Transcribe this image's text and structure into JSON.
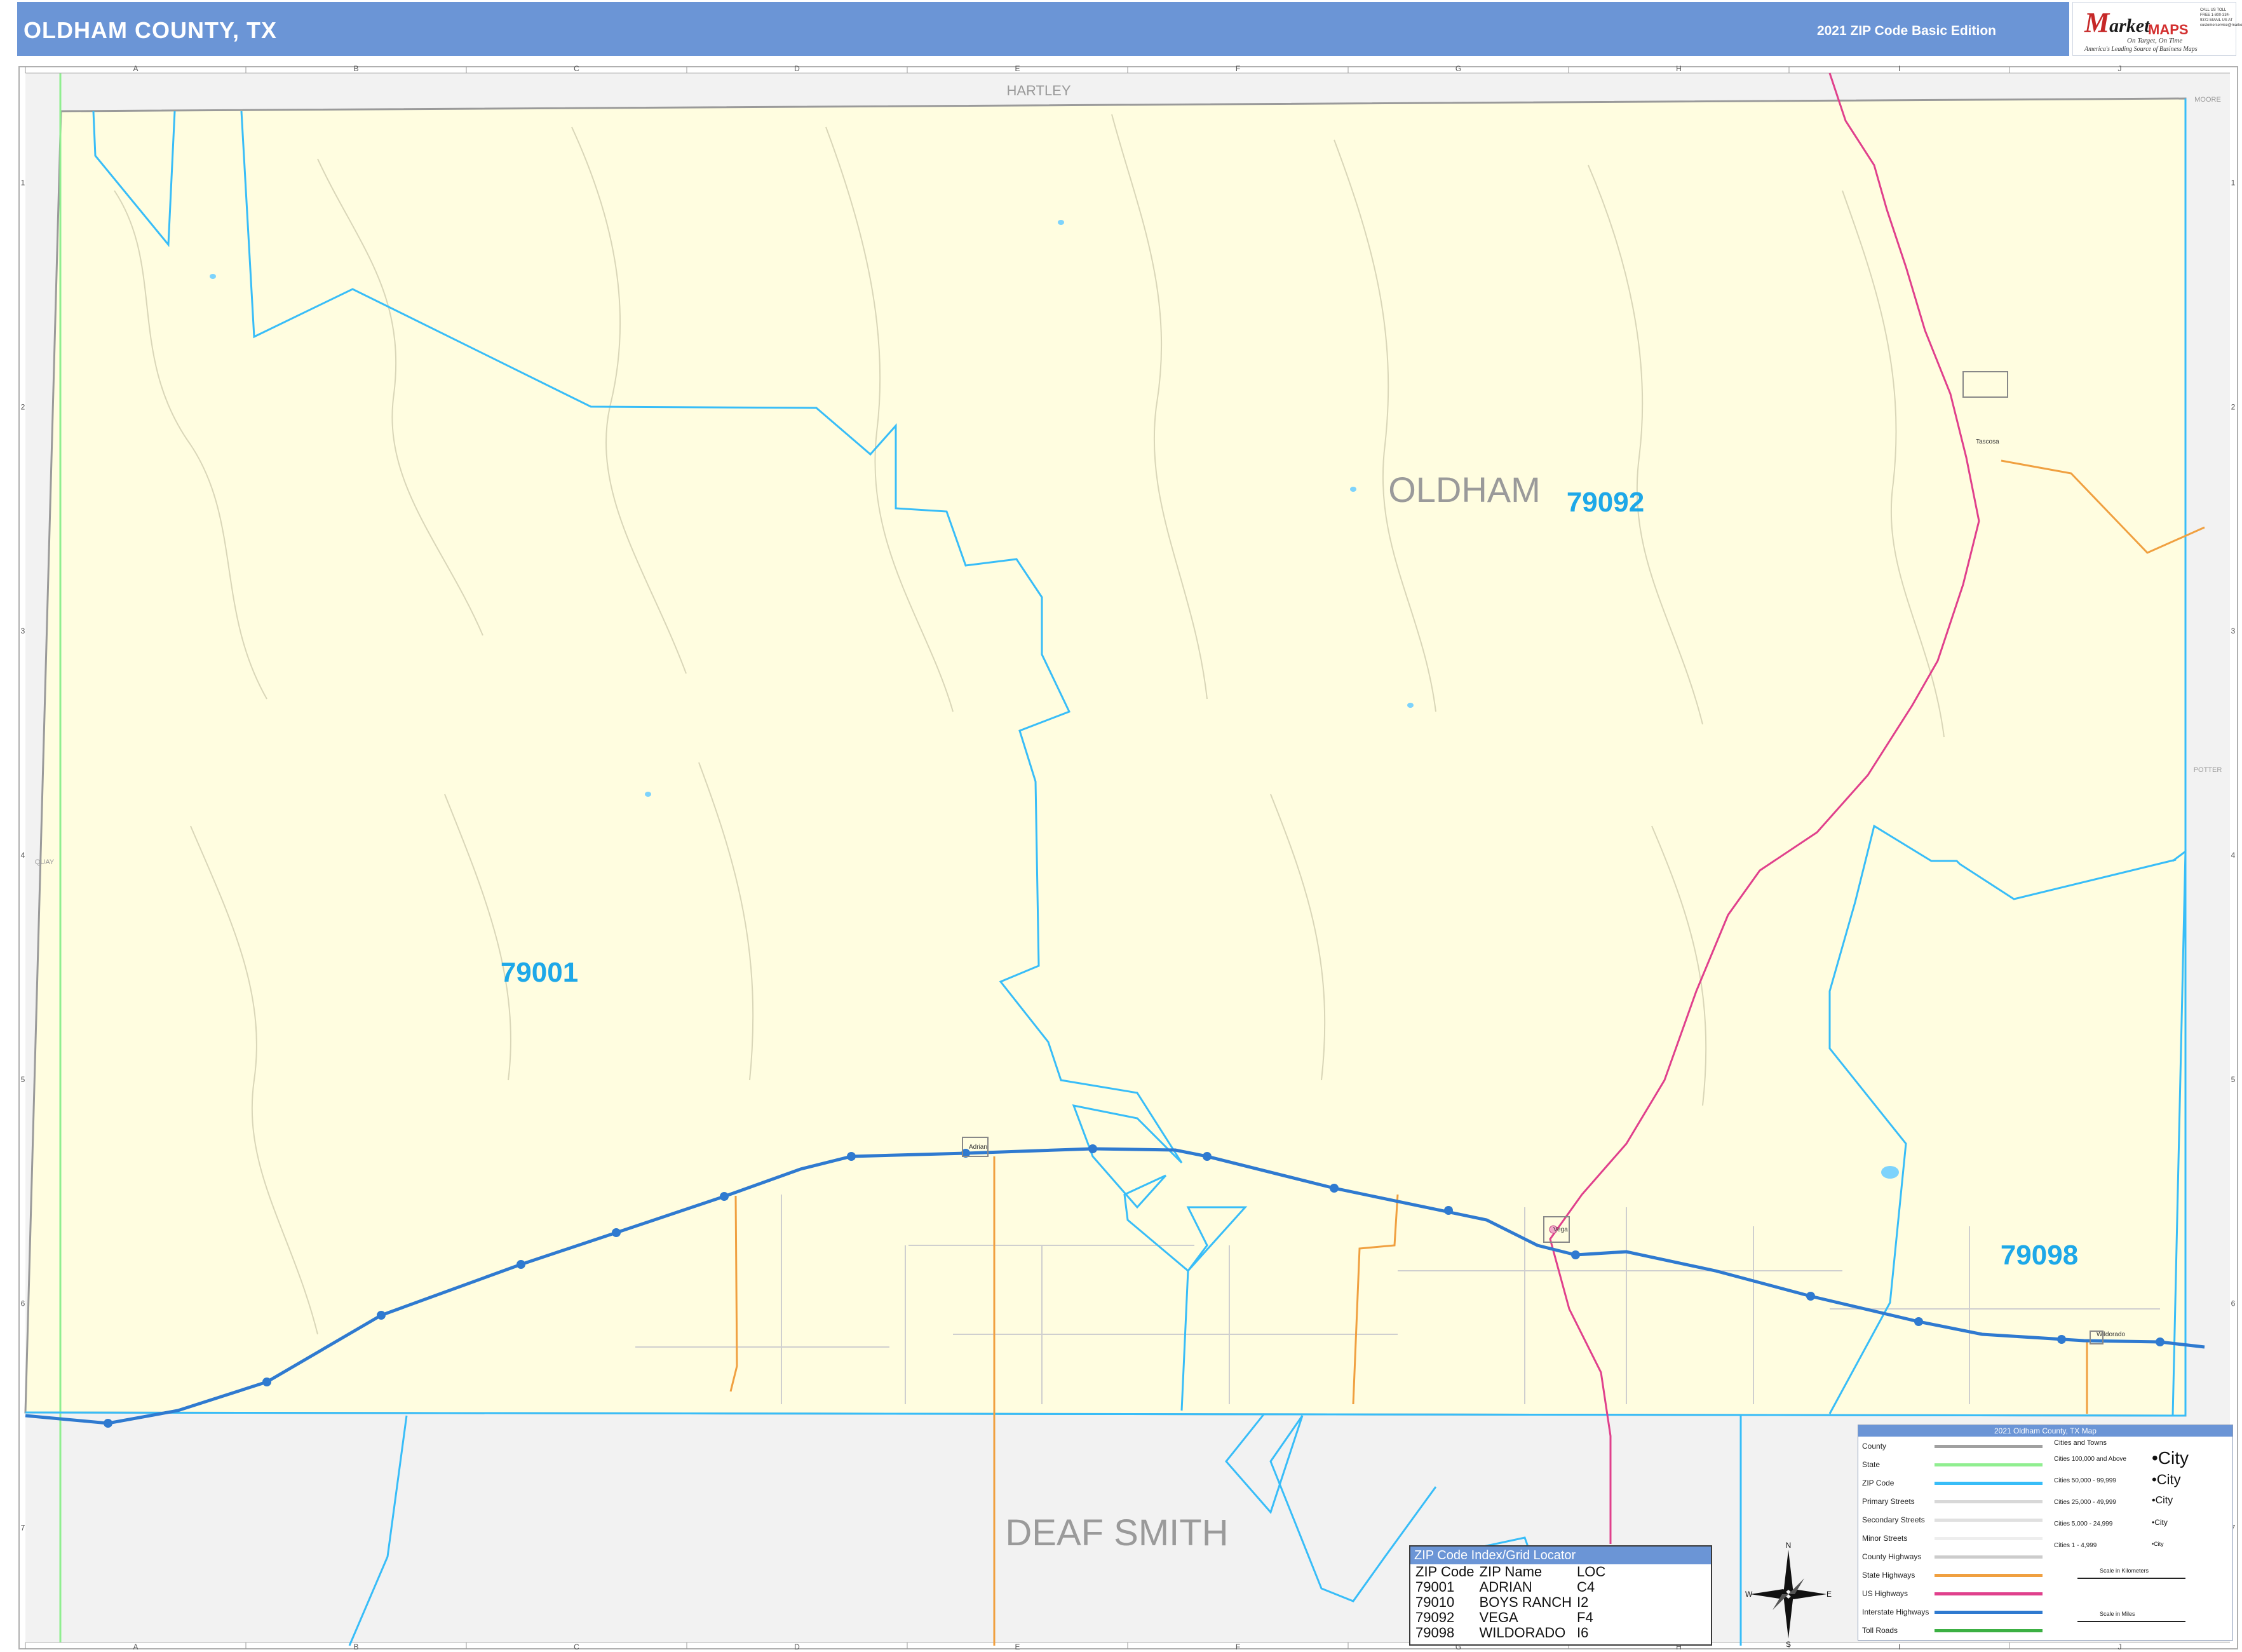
{
  "header": {
    "title": "OLDHAM COUNTY, TX",
    "edition": "2021 ZIP Code Basic Edition"
  },
  "logo": {
    "brand": "arket",
    "brand_letter": "M",
    "maps": "MAPS",
    "tagline": "On Target, On Time",
    "slogan": "America's Leading Source of Business Maps",
    "contact": "CALL US TOLL FREE 1-800-334-9372 EMAIL US AT customerservice@marketmaps.com"
  },
  "grid": {
    "columns": [
      "A",
      "B",
      "C",
      "D",
      "E",
      "F",
      "G",
      "H",
      "I",
      "J"
    ],
    "rows": [
      "1",
      "2",
      "3",
      "4",
      "5",
      "6",
      "7"
    ]
  },
  "counties": {
    "center": "OLDHAM",
    "north": "HARTLEY",
    "south": "DEAF SMITH",
    "west": "QUAY",
    "east": "POTTER",
    "northeast": "MOORE"
  },
  "zip_labels": [
    "79001",
    "79092",
    "79098"
  ],
  "places": [
    "Vega",
    "Adrian",
    "Wildorado",
    "Tascosa"
  ],
  "zip_index": {
    "title": "ZIP Code Index/Grid Locator",
    "headers": [
      "ZIP Code",
      "ZIP Name",
      "LOC"
    ],
    "rows": [
      [
        "79001",
        "ADRIAN",
        "C4"
      ],
      [
        "79010",
        "BOYS RANCH",
        "I2"
      ],
      [
        "79092",
        "VEGA",
        "F4"
      ],
      [
        "79098",
        "WILDORADO",
        "I6"
      ]
    ]
  },
  "compass": {
    "n": "N",
    "s": "S",
    "e": "E",
    "w": "W"
  },
  "legend": {
    "title": "2021 Oldham County, TX Map",
    "items": [
      {
        "label": "County",
        "color": "#a0a0a0"
      },
      {
        "label": "State",
        "color": "#90ee90"
      },
      {
        "label": "ZIP Code",
        "color": "#38bdf8"
      },
      {
        "label": "Primary Streets",
        "color": "#d8d8d8"
      },
      {
        "label": "Secondary Streets",
        "color": "#e0e0e0"
      },
      {
        "label": "Minor Streets",
        "color": "#eeeeee"
      },
      {
        "label": "County Highways",
        "color": "#cccccc"
      },
      {
        "label": "State Highways",
        "color": "#f0a040"
      },
      {
        "label": "US Highways",
        "color": "#e0408c"
      },
      {
        "label": "Interstate Highways",
        "color": "#2f7ad0"
      },
      {
        "label": "Toll Roads",
        "color": "#3cb043"
      }
    ],
    "cities_title": "Cities and Towns",
    "cities": [
      {
        "label": "Cities 100,000 and Above",
        "glyph": "City"
      },
      {
        "label": "Cities 50,000 - 99,999",
        "glyph": "City"
      },
      {
        "label": "Cities 25,000 - 49,999",
        "glyph": "City"
      },
      {
        "label": "Cities 5,000 - 24,999",
        "glyph": "City"
      },
      {
        "label": "Cities 1 - 4,999",
        "glyph": "City"
      }
    ],
    "scale_km": "Scale in Kilometers",
    "scale_mi": "Scale in Miles"
  },
  "colors": {
    "header": "#6b95d6",
    "county_fill": "#fffde0",
    "outside_fill": "#f2f2f2",
    "zip_line": "#38bdf8",
    "zip_text": "#1ea8e8",
    "interstate": "#2f7ad0",
    "us_highway": "#e0408c",
    "state_highway": "#f0a040",
    "county_text": "#9a9a9a"
  }
}
